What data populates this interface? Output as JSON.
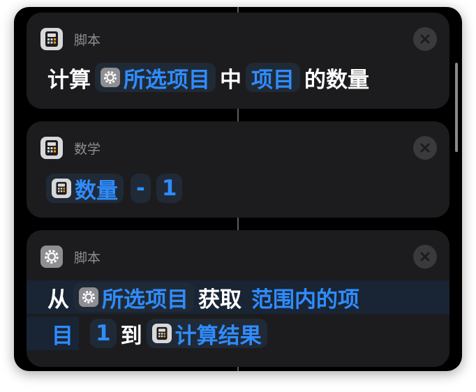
{
  "cards": [
    {
      "app": "脚本",
      "icon": "calculator-icon",
      "line": {
        "prefix": "计算",
        "token1": "所选项目",
        "mid": "中",
        "token2": "项目",
        "suffix": "的数量"
      }
    },
    {
      "app": "数学",
      "icon": "calculator-icon",
      "line": {
        "token1": "数量",
        "op": "-",
        "num": "1"
      }
    },
    {
      "app": "脚本",
      "icon": "gear-icon",
      "line1": {
        "prefix": "从",
        "token1": "所选项目",
        "mid": "获取",
        "token2a": "范围内的项"
      },
      "line2": {
        "token2b": "目",
        "num": "1",
        "to": "到",
        "token3": "计算结果"
      }
    }
  ],
  "colors": {
    "background": "#000000",
    "card": "#1c1c1e",
    "accent": "#2f8cff",
    "token_bg": "#202a36",
    "close_bg": "#3a3a3c"
  }
}
